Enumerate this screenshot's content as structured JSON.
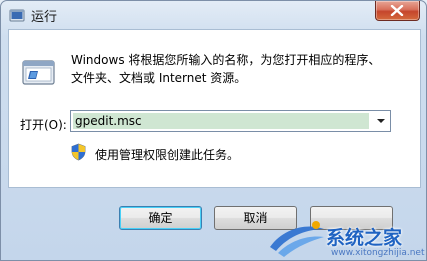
{
  "window": {
    "title": "运行",
    "close_icon": "close-icon"
  },
  "main": {
    "description_line1": "Windows 将根据您所输入的名称，为您打开相应的程序、",
    "description_line2": "文件夹、文档或 Internet 资源。",
    "open_label": "打开(O):",
    "open_value": "gpedit.msc",
    "admin_note": "使用管理权限创建此任务。"
  },
  "buttons": {
    "ok": "确定",
    "cancel": "取消",
    "browse": ""
  },
  "watermark": {
    "text": "系统之家",
    "url": "www.xitongzhijia.net"
  },
  "colors": {
    "selection": "#cfe6d2",
    "close_button": "#c5452c",
    "title_bar": "#cfdeef",
    "watermark": "#1f63c2"
  }
}
